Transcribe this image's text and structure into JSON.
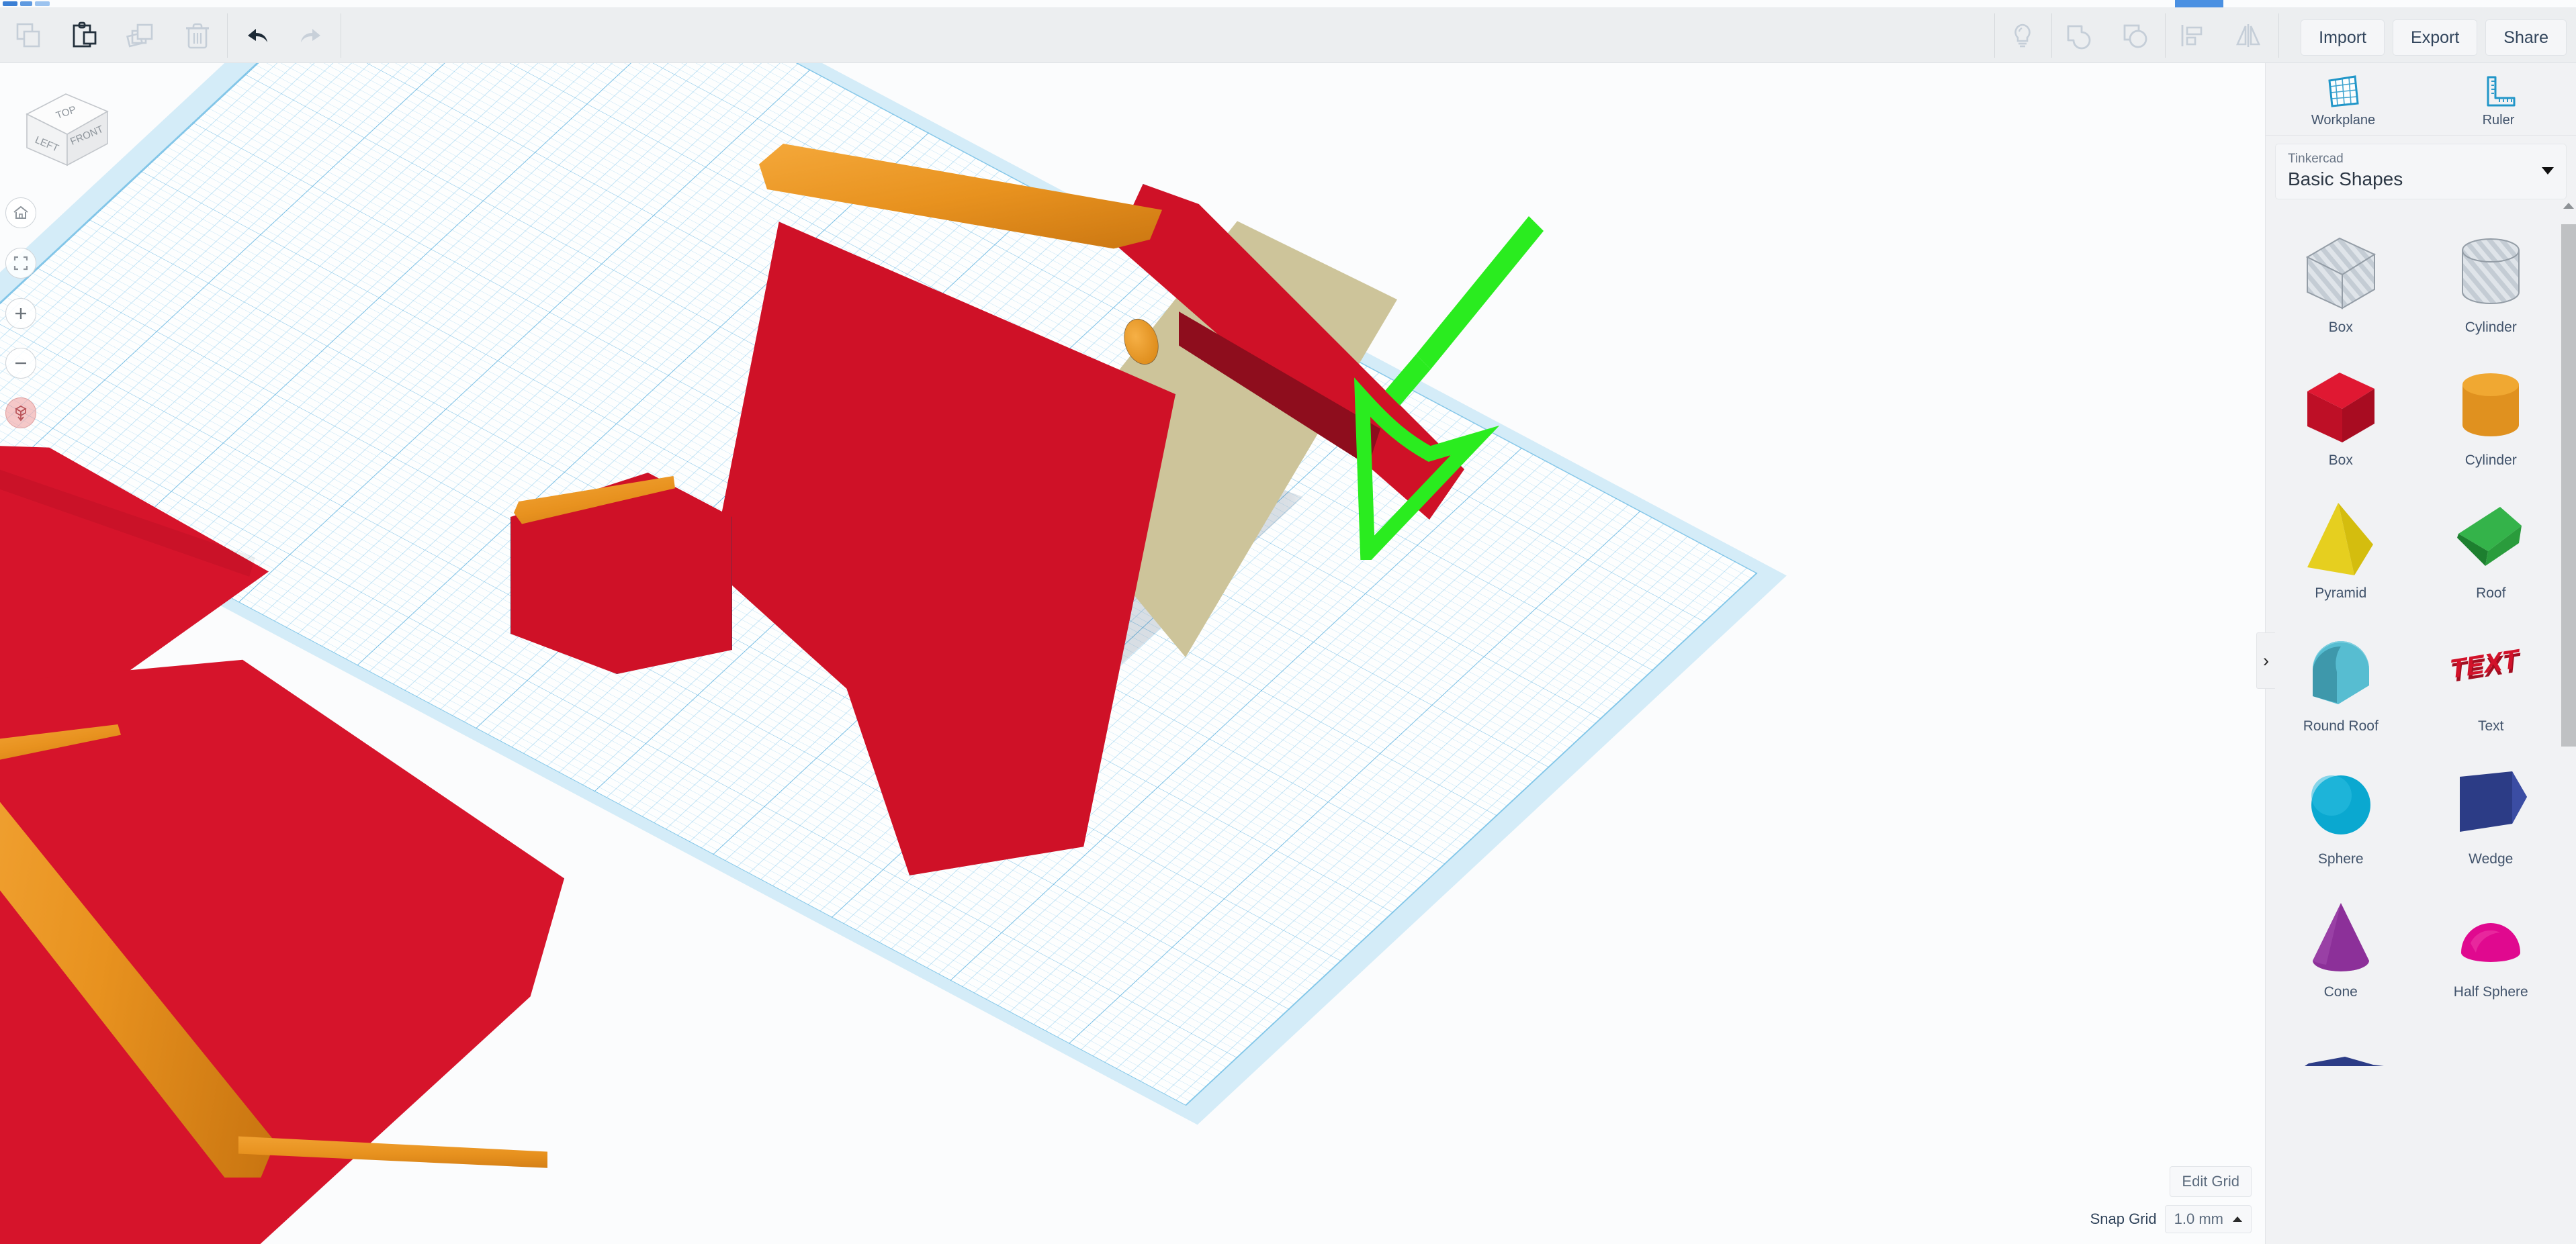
{
  "toolbar": {
    "left_tools": [
      {
        "name": "copy",
        "label": "Copy",
        "enabled": false
      },
      {
        "name": "paste",
        "label": "Paste",
        "enabled": true
      },
      {
        "name": "duplicate",
        "label": "Duplicate",
        "enabled": false
      },
      {
        "name": "delete",
        "label": "Delete",
        "enabled": false
      }
    ],
    "history_tools": [
      {
        "name": "undo",
        "label": "Undo",
        "enabled": true
      },
      {
        "name": "redo",
        "label": "Redo",
        "enabled": false
      }
    ],
    "right_tools": [
      {
        "name": "light",
        "label": "Light"
      },
      {
        "name": "group",
        "label": "Group"
      },
      {
        "name": "ungroup",
        "label": "Ungroup"
      },
      {
        "name": "align",
        "label": "Align"
      },
      {
        "name": "mirror",
        "label": "Mirror"
      }
    ],
    "actions": [
      {
        "name": "import",
        "label": "Import"
      },
      {
        "name": "export",
        "label": "Export"
      },
      {
        "name": "share",
        "label": "Share"
      }
    ]
  },
  "viewcube": {
    "top_face": "TOP",
    "left_face": "LEFT",
    "front_face": "FRONT"
  },
  "nav": {
    "home_label": "Home view",
    "fit_label": "Fit all in view",
    "zoom_in_label": "Zoom in",
    "zoom_out_label": "Zoom out",
    "flat_label": "Switch to flat view"
  },
  "grid_controls": {
    "edit_grid_label": "Edit Grid",
    "snap_label": "Snap Grid",
    "snap_value": "1.0 mm"
  },
  "sidebar": {
    "tools": [
      {
        "name": "workplane",
        "label": "Workplane"
      },
      {
        "name": "ruler",
        "label": "Ruler"
      }
    ],
    "dropdown": {
      "kicker": "Tinkercad",
      "title": "Basic Shapes"
    },
    "toggle_glyph": "›",
    "shapes": [
      {
        "label": "Box",
        "art": "box-hatched",
        "color": "#b9c2cb"
      },
      {
        "label": "Cylinder",
        "art": "cylinder-hatched",
        "color": "#b9c2cb"
      },
      {
        "label": "Box",
        "art": "box-solid",
        "color": "#cf1127"
      },
      {
        "label": "Cylinder",
        "art": "cylinder-solid",
        "color": "#e8921f"
      },
      {
        "label": "Pyramid",
        "art": "pyramid",
        "color": "#e8cf1b"
      },
      {
        "label": "Roof",
        "art": "roof",
        "color": "#2fa83f"
      },
      {
        "label": "Round Roof",
        "art": "round-roof",
        "color": "#52b7cb"
      },
      {
        "label": "Text",
        "art": "text",
        "color": "#c31127"
      },
      {
        "label": "Sphere",
        "art": "sphere",
        "color": "#07a6cf"
      },
      {
        "label": "Wedge",
        "art": "wedge",
        "color": "#2b3a81"
      },
      {
        "label": "Cone",
        "art": "cone",
        "color": "#8a2f96"
      },
      {
        "label": "Half Sphere",
        "art": "half-sphere",
        "color": "#e0098f"
      },
      {
        "label": "",
        "art": "partial-wedge",
        "color": "#2b3a81"
      }
    ]
  },
  "canvas": {
    "annotation": {
      "type": "arrow",
      "color": "#2aec1f",
      "direction": "down-left",
      "points_to": "empty-workplane-area"
    },
    "objects": [
      {
        "name": "tent-roof-main",
        "color": "#cf1127",
        "accent": "#e8921f"
      },
      {
        "name": "tent-inner-face",
        "color": "#cdc49a"
      },
      {
        "name": "roof-partial-left",
        "color": "#d6142b"
      },
      {
        "name": "roof-partial-bottom",
        "color": "#d6142b",
        "accent": "#e8921f"
      }
    ],
    "workplane": {
      "grid_minor_mm": 1,
      "grid_major_mm": 10
    }
  }
}
